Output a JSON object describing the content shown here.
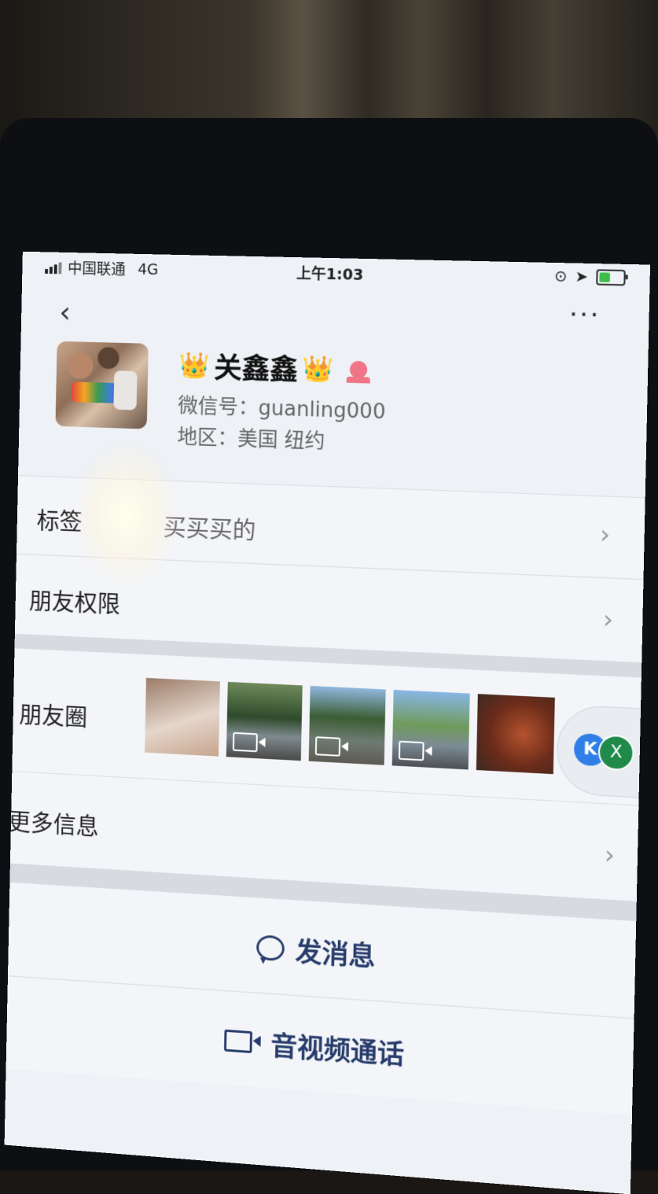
{
  "status_bar": {
    "carrier": "中国联通",
    "network": "4G",
    "time": "上午1:03"
  },
  "nav": {
    "back_icon": "chevron-left-icon",
    "more_icon": "more-dots-icon"
  },
  "profile": {
    "name": "关鑫鑫",
    "crown_emoji": "👑",
    "wechat_id": "微信号：guanling000",
    "region": "地区：美国 纽约"
  },
  "rows": {
    "tags": {
      "label": "标签",
      "value": "买买买的"
    },
    "permissions": {
      "label": "朋友权限"
    },
    "moments": {
      "label": "朋友圈"
    },
    "more_info": {
      "label": "更多信息"
    }
  },
  "floating_badge": {
    "letter": "X"
  },
  "actions": {
    "send_message": "发消息",
    "video_call": "音视频通话"
  },
  "colors": {
    "action_text": "#283c6b",
    "gender_badge": "#f07586"
  }
}
